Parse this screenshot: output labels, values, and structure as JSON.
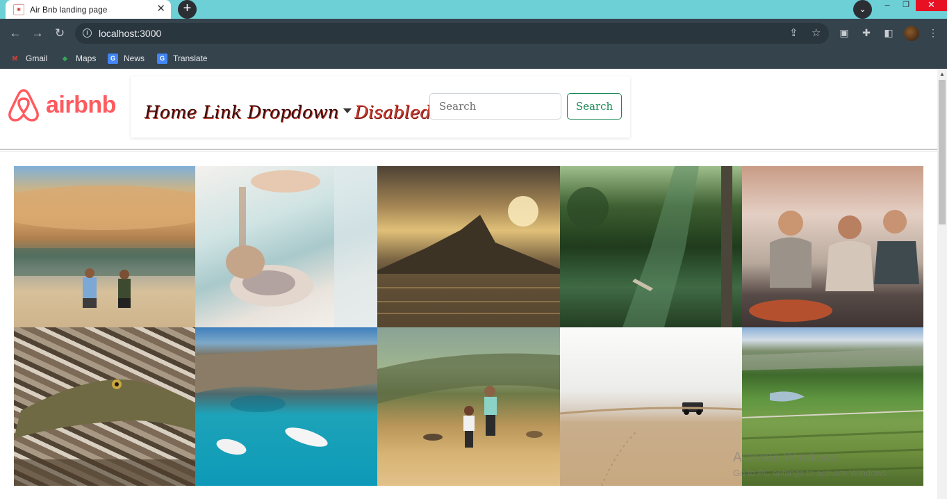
{
  "browser": {
    "tab_title": "Air Bnb landing page",
    "url": "localhost:3000",
    "bookmarks": [
      {
        "label": "Gmail",
        "icon": "gmail-icon"
      },
      {
        "label": "Maps",
        "icon": "maps-icon"
      },
      {
        "label": "News",
        "icon": "news-icon"
      },
      {
        "label": "Translate",
        "icon": "translate-icon"
      }
    ]
  },
  "brand": {
    "name": "airbnb",
    "color": "#ff5a5f"
  },
  "nav": {
    "home": "Home",
    "link": "Link",
    "dropdown": "Dropdown",
    "disabled": "Disabled"
  },
  "search": {
    "placeholder": "Search",
    "button_label": "Search",
    "button_color": "#198754"
  },
  "gallery": {
    "photos": [
      {
        "subject": "desert-dunes-with-two-people"
      },
      {
        "subject": "hands-holding-oyster"
      },
      {
        "subject": "sunset-over-sea-and-mountain"
      },
      {
        "subject": "forest-river-with-canoe"
      },
      {
        "subject": "friends-drinking-tea"
      },
      {
        "subject": "crocodile-in-leaves"
      },
      {
        "subject": "boats-in-turquoise-cove"
      },
      {
        "subject": "hikers-with-dogs-on-hill"
      },
      {
        "subject": "desert-with-jeep"
      },
      {
        "subject": "vineyard-and-river-valley"
      }
    ]
  },
  "watermark": {
    "title": "Activate Windows",
    "subtitle": "Go to PC settings to activate Windows."
  }
}
